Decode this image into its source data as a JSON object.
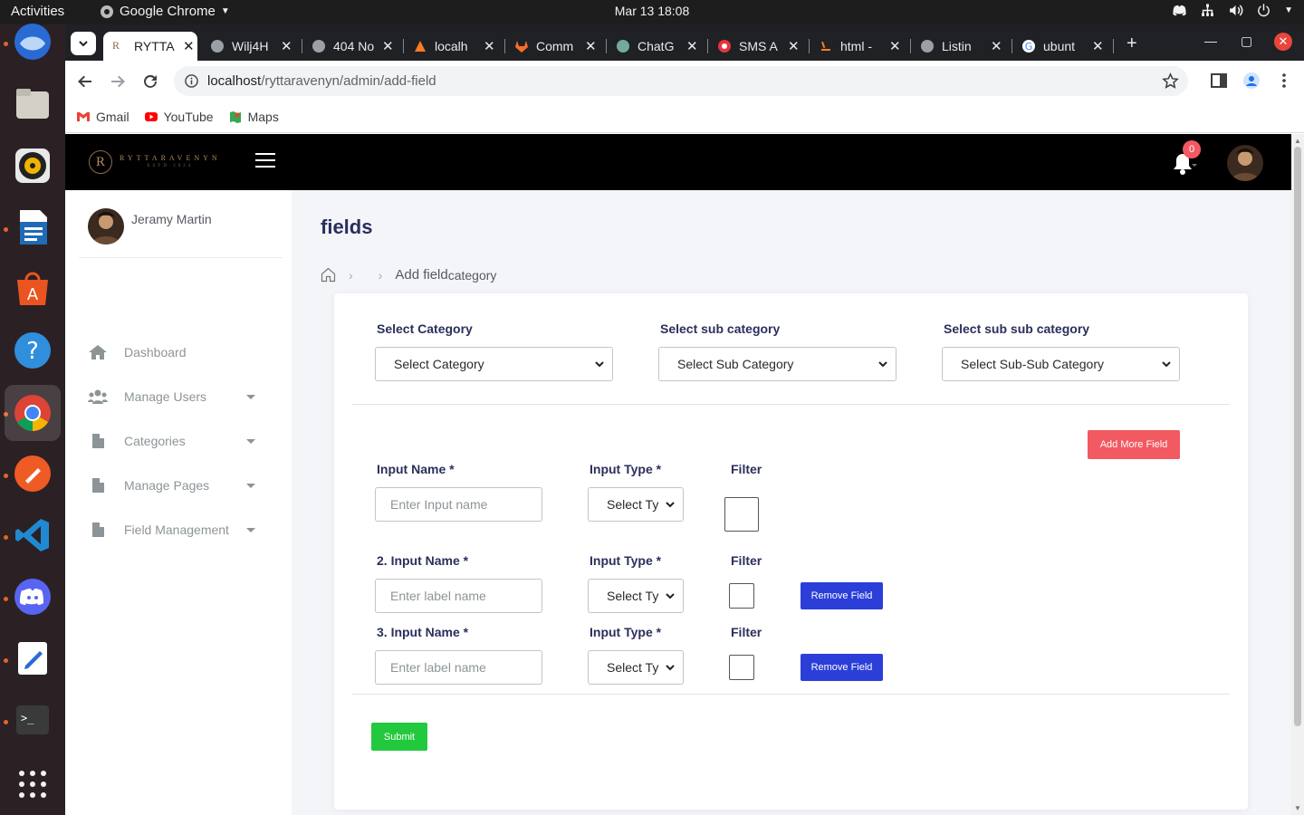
{
  "os": {
    "activities": "Activities",
    "app_name": "Google Chrome",
    "clock": "Mar 13  18:08"
  },
  "browser": {
    "tabs": [
      {
        "title": "RYTTA"
      },
      {
        "title": "Wilj4H"
      },
      {
        "title": "404 No"
      },
      {
        "title": "localh"
      },
      {
        "title": "Comm"
      },
      {
        "title": "ChatG"
      },
      {
        "title": "SMS A"
      },
      {
        "title": "html -"
      },
      {
        "title": "Listin"
      },
      {
        "title": "ubunt"
      }
    ],
    "url_host": "localhost",
    "url_path": "/ryttaravenyn/admin/add-field",
    "bookmarks": [
      "Gmail",
      "YouTube",
      "Maps"
    ]
  },
  "header": {
    "logo_letter": "R",
    "logo_name": "RYTTARAVENYN",
    "logo_sub": "ESTD 2024",
    "notification_count": "0"
  },
  "sidebar": {
    "user_name": "Jeramy Martin",
    "items": [
      {
        "label": "Dashboard",
        "icon": "home-icon"
      },
      {
        "label": "Manage Users",
        "icon": "users-icon"
      },
      {
        "label": "Categories",
        "icon": "file-icon"
      },
      {
        "label": "Manage Pages",
        "icon": "file-icon"
      },
      {
        "label": "Field Management",
        "icon": "file-icon"
      }
    ]
  },
  "main": {
    "title": "fields",
    "breadcrumb_current": "Add field",
    "breadcrumb_suffix": "category",
    "select_category_label": "Select Category",
    "select_category_value": "Select Category",
    "select_subcategory_label": "Select sub category",
    "select_subcategory_value": "Select Sub Category",
    "select_subsubcategory_label": "Select sub sub category",
    "select_subsubcategory_value": "Select Sub-Sub Category",
    "add_more_label": "Add More Field",
    "fields": [
      {
        "name_label": "Input Name *",
        "type_label": "Input Type *",
        "filter_label": "Filter",
        "placeholder": "Enter Input name",
        "type_value": "Select Ty"
      },
      {
        "name_label": "2. Input Name *",
        "type_label": "Input Type *",
        "filter_label": "Filter",
        "placeholder": "Enter label name",
        "type_value": "Select Ty",
        "remove_label": "Remove Field"
      },
      {
        "name_label": "3. Input Name *",
        "type_label": "Input Type *",
        "filter_label": "Filter",
        "placeholder": "Enter label name",
        "type_value": "Select Ty",
        "remove_label": "Remove Field"
      }
    ],
    "submit_label": "Submit"
  },
  "colors": {
    "header_bg": "#000000",
    "add_more_btn": "#f25961",
    "remove_btn": "#2b3fd8",
    "submit_btn": "#22c93e",
    "badge": "#f25961"
  }
}
